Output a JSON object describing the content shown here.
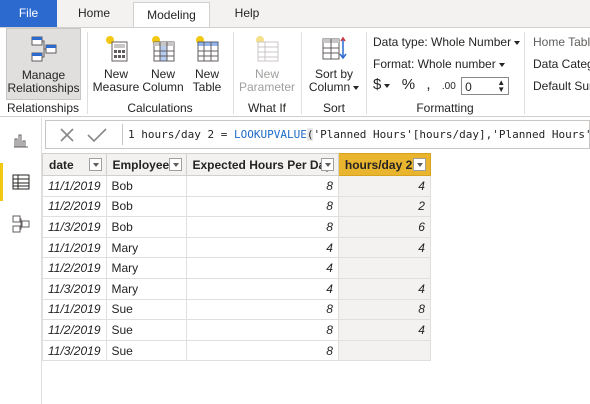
{
  "tabs": {
    "file": "File",
    "home": "Home",
    "modeling": "Modeling",
    "help": "Help"
  },
  "ribbon": {
    "manage_relationships": "Manage Relationships",
    "manage_relationships_l1": "Manage",
    "manage_relationships_l2": "Relationships",
    "new_measure_l1": "New",
    "new_measure_l2": "Measure",
    "new_column_l1": "New",
    "new_column_l2": "Column",
    "new_table_l1": "New",
    "new_table_l2": "Table",
    "new_parameter_l1": "New",
    "new_parameter_l2": "Parameter",
    "sort_by_column_l1": "Sort by",
    "sort_by_column_l2": "Column",
    "groups": {
      "relationships": "Relationships",
      "calculations": "Calculations",
      "whatif": "What If",
      "sort": "Sort",
      "formatting": "Formatting"
    },
    "data_type": "Data type: Whole Number",
    "format": "Format: Whole number",
    "currency_symbol": "$",
    "percent_symbol": "%",
    "comma_symbol": ",",
    "decimals_symbol": ".00",
    "decimal_places": "0",
    "home_table": "Home Table",
    "data_category": "Data Categ",
    "default_summarization": "Default Sur"
  },
  "formula_bar": {
    "line_no": "1",
    "prefix": " hours/day 2 = ",
    "fn": "LOOKUPVALUE",
    "open_paren": "(",
    "rest": "'Planned Hours'[hours/day],'Planned Hours'"
  },
  "table": {
    "columns": [
      "date",
      "Employee",
      "Expected Hours Per Day",
      "hours/day 2"
    ],
    "rows": [
      [
        "11/1/2019",
        "Bob",
        "8",
        "4"
      ],
      [
        "11/2/2019",
        "Bob",
        "8",
        "2"
      ],
      [
        "11/3/2019",
        "Bob",
        "8",
        "6"
      ],
      [
        "11/1/2019",
        "Mary",
        "4",
        "4"
      ],
      [
        "11/2/2019",
        "Mary",
        "4",
        ""
      ],
      [
        "11/3/2019",
        "Mary",
        "4",
        "4"
      ],
      [
        "11/1/2019",
        "Sue",
        "8",
        "8"
      ],
      [
        "11/2/2019",
        "Sue",
        "8",
        "4"
      ],
      [
        "11/3/2019",
        "Sue",
        "8",
        ""
      ]
    ]
  },
  "colors": {
    "accent_tab": "#2d6ad0",
    "selected_column": "#e9b52f",
    "nav_active": "#f2c811"
  }
}
